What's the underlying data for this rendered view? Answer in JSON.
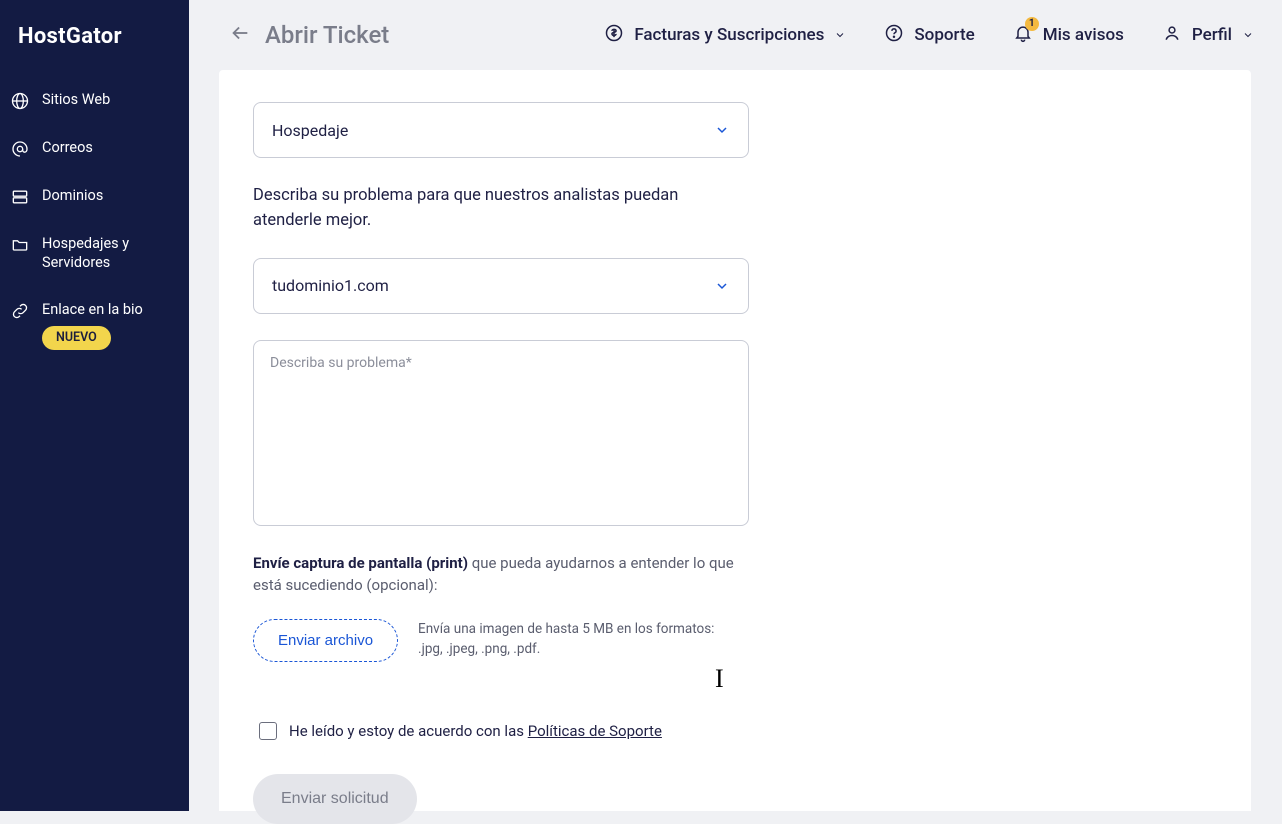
{
  "brand": "HostGator",
  "sidebar": {
    "items": [
      {
        "label": "Sitios Web"
      },
      {
        "label": "Correos"
      },
      {
        "label": "Dominios"
      },
      {
        "label": "Hospedajes y Servidores"
      },
      {
        "label": "Enlace en la bio",
        "badge": "NUEVO"
      }
    ]
  },
  "topbar": {
    "page_title": "Abrir Ticket",
    "billing": "Facturas y Suscripciones",
    "support": "Soporte",
    "notices": "Mis avisos",
    "notice_count": "1",
    "profile": "Perfil"
  },
  "form": {
    "select_category": "Hospedaje",
    "instructions": "Describa su problema para que nuestros analistas puedan atenderle mejor.",
    "select_domain": "tudominio1.com",
    "textarea_placeholder": "Describa su problema*",
    "screenshot_bold": "Envíe captura de pantalla (print)",
    "screenshot_rest": " que pueda ayudarnos a entender lo que está sucediendo (opcional):",
    "upload_button": "Enviar archivo",
    "upload_hint_l1": "Envía una imagen de hasta 5 MB en los formatos:",
    "upload_hint_l2": ".jpg, .jpeg, .png, .pdf.",
    "agree_prefix": "He leído y estoy de acuerdo con las ",
    "agree_link": "Políticas de Soporte",
    "submit": "Enviar solicitud"
  }
}
